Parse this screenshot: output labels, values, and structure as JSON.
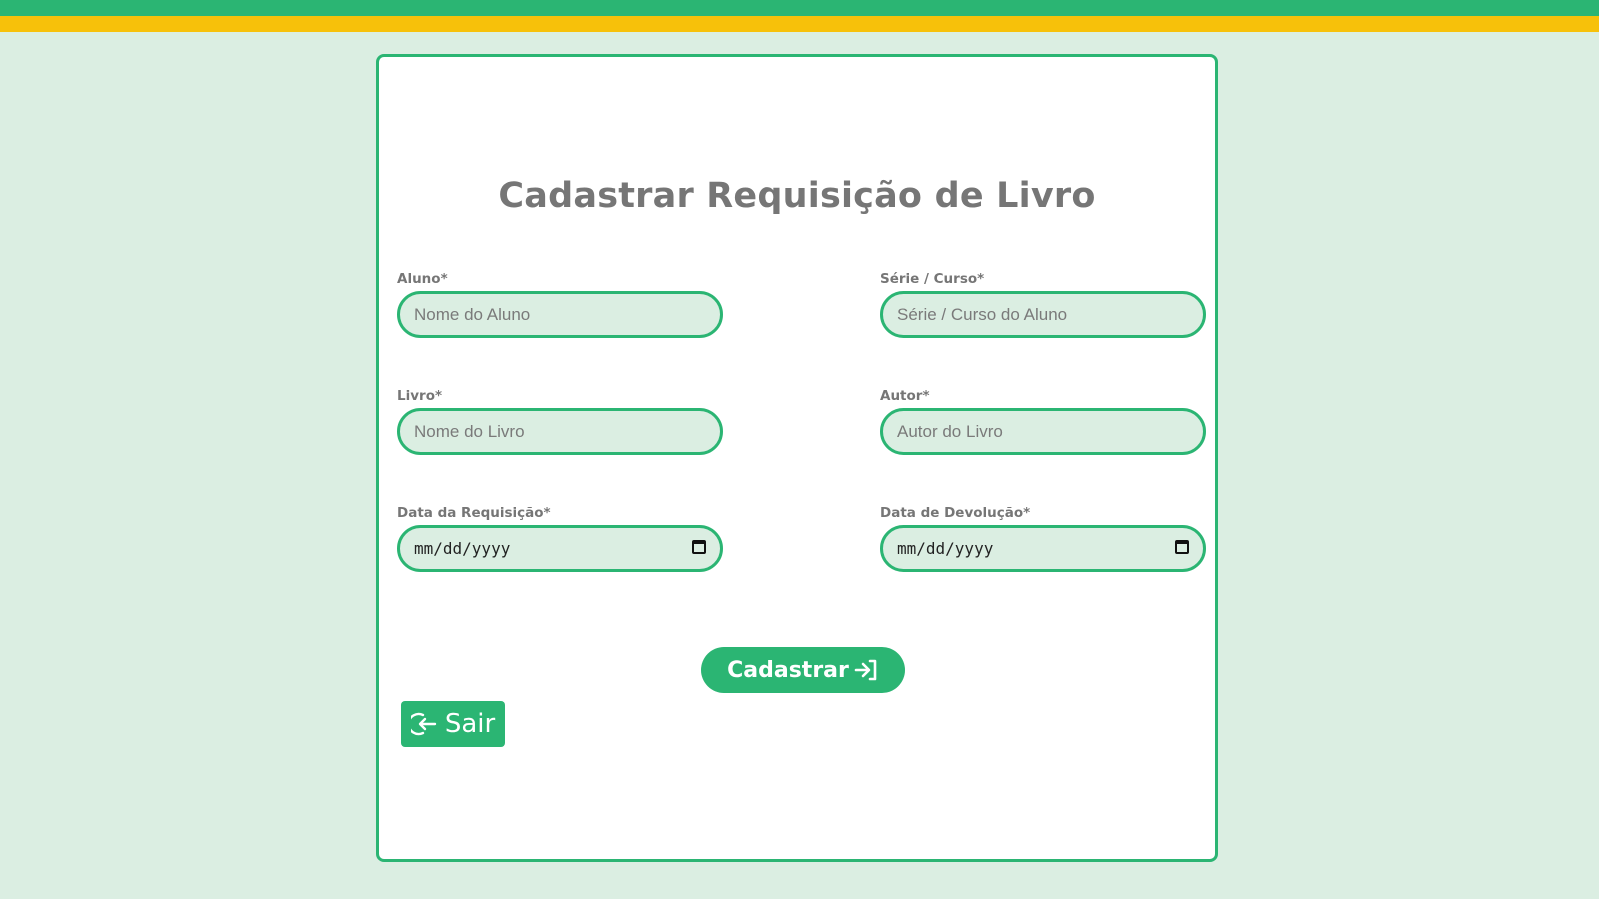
{
  "colors": {
    "accent": "#2bb573",
    "top_stripe_yellow": "#f7c10a",
    "background": "#dbeee2",
    "card": "#ffffff",
    "heading_text": "#767676"
  },
  "form": {
    "title": "Cadastrar Requisição de Livro",
    "fields": {
      "aluno": {
        "label": "Aluno*",
        "placeholder": "Nome do Aluno",
        "value": ""
      },
      "serie": {
        "label": "Série / Curso*",
        "placeholder": "Série / Curso do Aluno",
        "value": ""
      },
      "livro": {
        "label": "Livro*",
        "placeholder": "Nome do Livro",
        "value": ""
      },
      "autor": {
        "label": "Autor*",
        "placeholder": "Autor do Livro",
        "value": ""
      },
      "data_requisicao": {
        "label": "Data da Requisição*",
        "display": "mm/dd/yyyy",
        "icon": "calendar-icon"
      },
      "data_devolucao": {
        "label": "Data de Devolução*",
        "display": "mm/dd/yyyy",
        "icon": "calendar-icon"
      }
    },
    "submit_label": "Cadastrar",
    "submit_icon": "login-arrow-icon",
    "exit_label": "Sair",
    "exit_icon": "logout-arrow-icon"
  }
}
